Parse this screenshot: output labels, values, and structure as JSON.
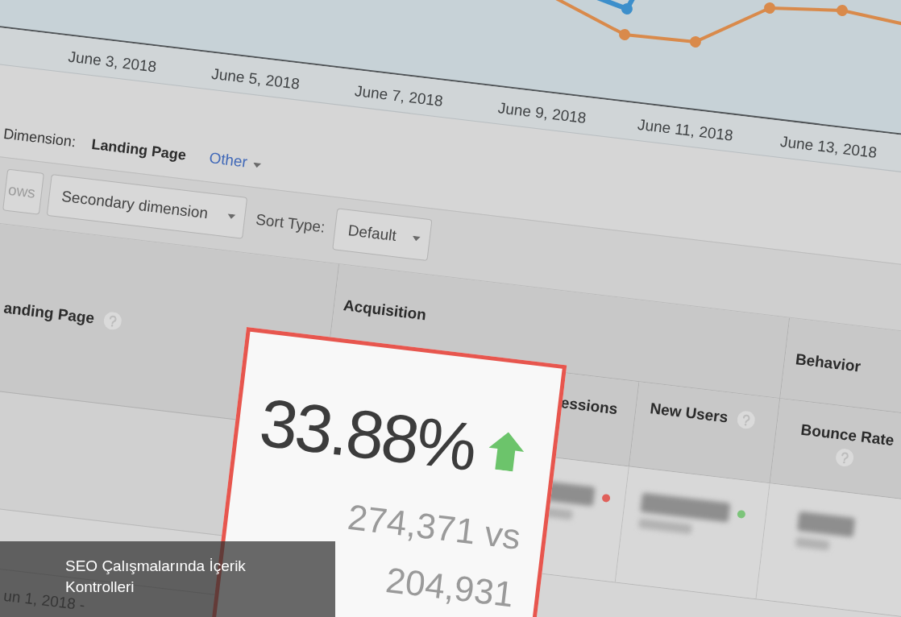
{
  "chart": {
    "x_labels": [
      "June 3, 2018",
      "June 5, 2018",
      "June 7, 2018",
      "June 9, 2018",
      "June 11, 2018",
      "June 13, 2018"
    ]
  },
  "primary_dimension": {
    "label": "Dimension:",
    "items": [
      {
        "label": "Landing Page",
        "selected": true,
        "kind": "option"
      },
      {
        "label": "Other",
        "selected": false,
        "kind": "menu"
      }
    ]
  },
  "toolbar": {
    "items": [
      {
        "kind": "button",
        "label": "ows",
        "disabled": true
      },
      {
        "kind": "dropdown",
        "label": "Secondary dimension",
        "disabled": false
      },
      {
        "kind": "label",
        "label": "Sort Type:",
        "disabled": false
      },
      {
        "kind": "dropdown",
        "label": "Default",
        "disabled": false
      }
    ]
  },
  "table": {
    "groups": [
      {
        "label": "Acquisition"
      },
      {
        "label": "Behavior"
      }
    ],
    "columns": [
      {
        "label": "anding Page",
        "help_icon": true
      },
      {
        "label": "essions",
        "help_icon": false
      },
      {
        "label": "New Users",
        "help_icon": true
      },
      {
        "label": "Bounce Rate",
        "help_icon": true
      }
    ],
    "summary_cells": [
      {
        "kind": "blurred",
        "color": "#e0605a"
      },
      {
        "kind": "blurred",
        "color": "#7cc47a"
      },
      {
        "kind": "blurred"
      }
    ],
    "date_range": "un 1, 2018 -"
  },
  "callout": {
    "value": "33.88%",
    "increase": true,
    "comparison": [
      "274,371 vs",
      "204,931"
    ]
  },
  "caption": {
    "title": "SEO Çalışmalarında İçerik Kontrolleri"
  }
}
